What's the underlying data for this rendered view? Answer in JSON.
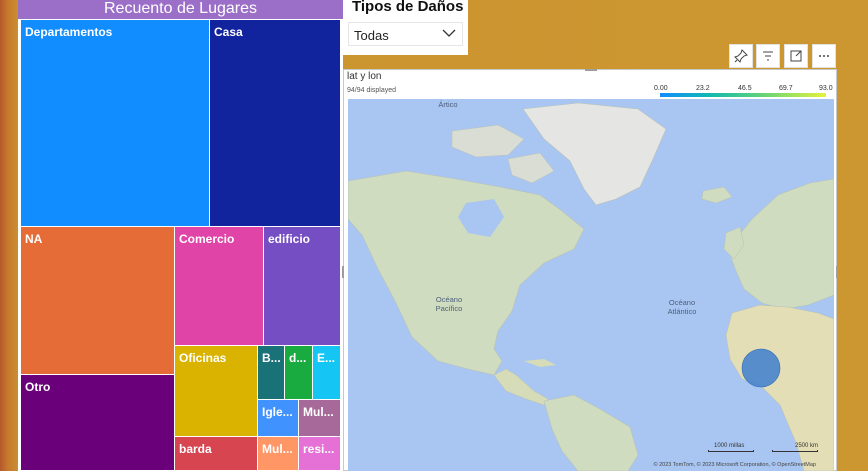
{
  "treemap": {
    "title": "Recuento de Lugares",
    "tiles": [
      {
        "label": "Departamentos",
        "color": "#118dff"
      },
      {
        "label": "Casa",
        "color": "#12239e"
      },
      {
        "label": "NA",
        "color": "#e66c37"
      },
      {
        "label": "Comercio",
        "color": "#e044a7"
      },
      {
        "label": "edificio",
        "color": "#744ec2"
      },
      {
        "label": "Otro",
        "color": "#6b007b"
      },
      {
        "label": "Oficinas",
        "color": "#d9b300"
      },
      {
        "label": "B...",
        "color": "#197278"
      },
      {
        "label": "d...",
        "color": "#1aab40"
      },
      {
        "label": "E...",
        "color": "#15c6f4"
      },
      {
        "label": "Igle...",
        "color": "#4092ff"
      },
      {
        "label": "Mul...",
        "color": "#a66999"
      },
      {
        "label": "barda",
        "color": "#d64550"
      },
      {
        "label": "Mul...",
        "color": "#fe9666"
      },
      {
        "label": "resi...",
        "color": "#e571d6"
      }
    ]
  },
  "slicer": {
    "title": "Tipos de Daños",
    "selected": "Todas"
  },
  "map": {
    "title": "lat y lon",
    "displayed": "94/94 displayed",
    "legend_ticks": [
      "0.00",
      "23.2",
      "46.5",
      "69.7",
      "93.0"
    ],
    "labels": {
      "arctic": "Ártico",
      "pacific": "Océano\nPacífico",
      "atlantic": "Océano\nAtlántico"
    },
    "scale": {
      "miles": "1000 millas",
      "km": "2500 km"
    },
    "copyright": "© 2023 TomTom, © 2023 Microsoft Corporation, © OpenStreetMap",
    "bubble_color": "#3f7fcf"
  }
}
